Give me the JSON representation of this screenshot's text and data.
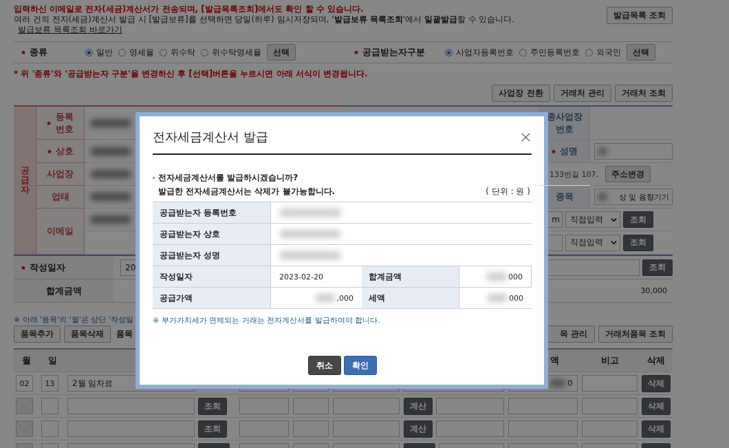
{
  "notice": {
    "lines": [
      {
        "kind": "alert",
        "text": "입력하신 이메일로 전자(세금)계산서가 전송되며, [발급목록조회]에서도 확인 할 수 있습니다."
      },
      {
        "kind": "info",
        "text": "여러 건의 전자(세금)계산서 발급 시 [발급보류]를 선택하면 당일(하루) 임시저장되며, '**발급보류 목록조회**'에서 **일괄발급**할 수 있습니다."
      }
    ],
    "link": "발급보류 목록조회 바로가기",
    "button": "발급목록 조회"
  },
  "type_row": {
    "groups": [
      {
        "label": "종류",
        "required": true,
        "options": [
          {
            "label": "일반",
            "selected": true
          },
          {
            "label": "영세율",
            "selected": false
          },
          {
            "label": "위수탁",
            "selected": false
          },
          {
            "label": "위수탁영세율",
            "selected": false
          }
        ],
        "button": "선택"
      },
      {
        "label": "공급받는자구분",
        "required": true,
        "options": [
          {
            "label": "사업자등록번호",
            "selected": true
          },
          {
            "label": "주민등록번호",
            "selected": false
          },
          {
            "label": "외국인",
            "selected": false
          }
        ],
        "button": "선택"
      }
    ]
  },
  "warning": "* 위 '종류'와 '공급받는자 구분'을 변경하신 후 [선택]버튼을 누르시면 아래 서식이 변경됩니다.",
  "partner_buttons": [
    "사업장 전환",
    "거래처 관리",
    "거래처 조회"
  ],
  "supplier": {
    "side_label": "공급자",
    "rows": [
      {
        "label": "등록번호",
        "required": true,
        "blurred": true,
        "right": {
          "kind": "label",
          "label": "종사업장 번호",
          "required": false
        }
      },
      {
        "label": "상호",
        "required": true,
        "blurred": true,
        "right": {
          "kind": "label-field",
          "label": "성명",
          "required": true,
          "blurred": true
        }
      },
      {
        "label": "사업장",
        "required": false,
        "blurred": true,
        "right": {
          "kind": "address",
          "text": "133번길 107,",
          "button": "주소변경"
        }
      },
      {
        "label": "업태",
        "required": false,
        "blurred": true,
        "right": {
          "kind": "label-field",
          "label": "종목",
          "required": false,
          "blurred": true,
          "value": "상 및 음향기기"
        }
      },
      {
        "label": "이메일",
        "required": false,
        "blurred": true,
        "right": {
          "kind": "email",
          "lines": [
            {
              "value": "m",
              "select": "직접입력",
              "button": "조회"
            },
            {
              "select": "직접입력",
              "button": "조회"
            }
          ]
        }
      }
    ]
  },
  "date_row": {
    "label": "작성일자",
    "required": true,
    "value": "20",
    "button": "조회"
  },
  "total_row": {
    "label": "합계금액",
    "value": "30,000"
  },
  "items": {
    "note": "※ 아래 '품목'의 '월'은 상단 '작성일",
    "left_buttons": [
      "품목추가",
      "품목삭제"
    ],
    "caption": "품목",
    "right_buttons": [
      "목 관리",
      "거래처품목 조회"
    ],
    "header": {
      "month": "월",
      "day": "일",
      "column_8": "액",
      "remark": "비고",
      "delete": "삭제"
    },
    "rows": [
      {
        "month": "02",
        "day": "13",
        "month_disabled": false,
        "item": "2월 임차료",
        "column_8": "0",
        "column_8_blurred": true,
        "delete": "삭제"
      },
      {
        "month_disabled": true,
        "lookup": "조회",
        "calc": "계산",
        "delete": "삭제"
      },
      {
        "month_disabled": true,
        "lookup": "조회",
        "calc": "계산",
        "delete": "삭제"
      },
      {
        "month_disabled": true,
        "cut": true
      }
    ]
  },
  "dialog": {
    "title": "전자세금계산서 발급",
    "message": [
      "전자세금계산서를 발급하시겠습니까?",
      "발급한 전자세금계산서는 삭제가 불가능합니다."
    ],
    "unit": "( 단위 : 원 )",
    "rows": [
      {
        "kind": "full",
        "label": "공급받는자 등록번호",
        "blurred": true
      },
      {
        "kind": "full",
        "label": "공급받는자 상호",
        "blurred": true
      },
      {
        "kind": "full",
        "label": "공급받는자 성명",
        "blurred": true
      },
      {
        "kind": "pair",
        "cells": [
          {
            "label": "작성일자",
            "value": "2023-02-20",
            "blurred": false
          },
          {
            "label": "합계금액",
            "value": "000",
            "blurred": true
          }
        ]
      },
      {
        "kind": "pair",
        "cells": [
          {
            "label": "공급가액",
            "value": ",000",
            "blurred": true
          },
          {
            "label": "세액",
            "value": "000",
            "blurred": true
          }
        ]
      }
    ],
    "note": "※ 부가가치세가 면제되는 거래는 전자계산서를 발급하여야 합니다.",
    "buttons": [
      {
        "label": "취소",
        "kind": "cancel"
      },
      {
        "label": "확인",
        "kind": "confirm"
      }
    ]
  }
}
